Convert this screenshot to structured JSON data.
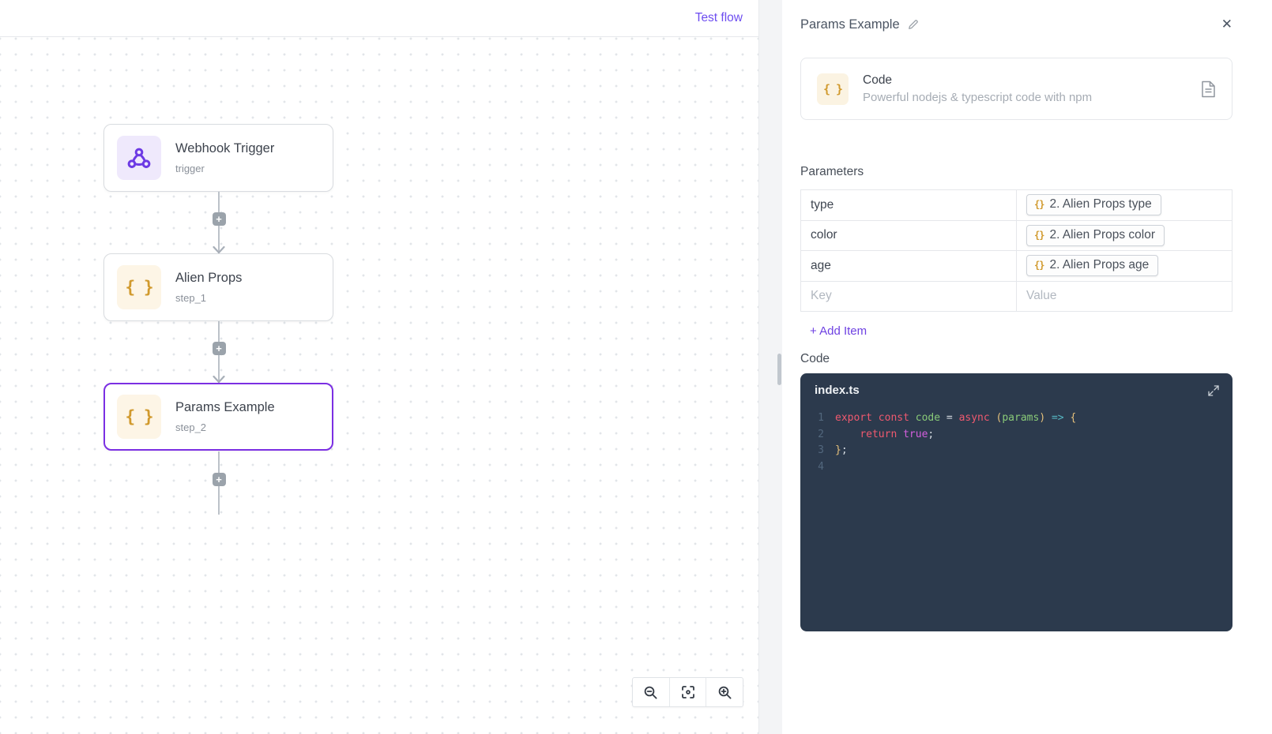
{
  "topbar": {
    "test_flow_label": "Test flow"
  },
  "canvas": {
    "braces_glyph": "{ }",
    "add_step_glyph": "+",
    "nodes": [
      {
        "title": "Webhook Trigger",
        "subtitle": "trigger",
        "icon": "webhook-icon",
        "selected": false
      },
      {
        "title": "Alien Props",
        "subtitle": "step_1",
        "icon": "braces-icon",
        "selected": false
      },
      {
        "title": "Params Example",
        "subtitle": "step_2",
        "icon": "braces-icon",
        "selected": true
      }
    ],
    "controls": [
      {
        "name": "zoom-out"
      },
      {
        "name": "fit-view"
      },
      {
        "name": "zoom-in"
      }
    ]
  },
  "panel": {
    "title": "Params Example",
    "close_glyph": "✕",
    "block": {
      "title": "Code",
      "subtitle": "Powerful nodejs & typescript code with npm",
      "icon_glyph": "{ }"
    },
    "parameters": {
      "heading": "Parameters",
      "chip_glyph": "{}",
      "rows": [
        {
          "key": "type",
          "token": "2. Alien Props type"
        },
        {
          "key": "color",
          "token": "2. Alien Props color"
        },
        {
          "key": "age",
          "token": "2. Alien Props age"
        }
      ],
      "empty_row": {
        "key_placeholder": "Key",
        "value_placeholder": "Value"
      },
      "add_item_label": "+ Add Item"
    },
    "code_section": {
      "heading": "Code",
      "filename": "index.ts",
      "token_colors": {
        "kw": "#ef596f",
        "name": "#89ca78",
        "plain": "#d7dde3",
        "paren": "#e5c07b",
        "arrow": "#56b6c2",
        "bool": "#d55fde"
      },
      "lines": [
        {
          "no": "1",
          "tokens": [
            [
              "kw",
              "export"
            ],
            [
              "plain",
              " "
            ],
            [
              "kw",
              "const"
            ],
            [
              "plain",
              " "
            ],
            [
              "name",
              "code"
            ],
            [
              "plain",
              " = "
            ],
            [
              "kw",
              "async"
            ],
            [
              "plain",
              " "
            ],
            [
              "paren",
              "("
            ],
            [
              "name",
              "params"
            ],
            [
              "paren",
              ")"
            ],
            [
              "plain",
              " "
            ],
            [
              "arrow",
              "=>"
            ],
            [
              "plain",
              " "
            ],
            [
              "paren",
              "{"
            ]
          ]
        },
        {
          "no": "2",
          "tokens": [
            [
              "plain",
              "    "
            ],
            [
              "kw",
              "return"
            ],
            [
              "plain",
              " "
            ],
            [
              "bool",
              "true"
            ],
            [
              "plain",
              ";"
            ]
          ]
        },
        {
          "no": "3",
          "tokens": [
            [
              "paren",
              "}"
            ],
            [
              "plain",
              ";"
            ]
          ]
        },
        {
          "no": "4",
          "tokens": []
        }
      ]
    }
  },
  "colors": {
    "accent_purple": "#6e41e2",
    "selection_border": "#7b2fe3",
    "amber": "#d19a2e",
    "webhook_purple": "#6d3ae4",
    "editor_bg": "#2c3a4d"
  }
}
